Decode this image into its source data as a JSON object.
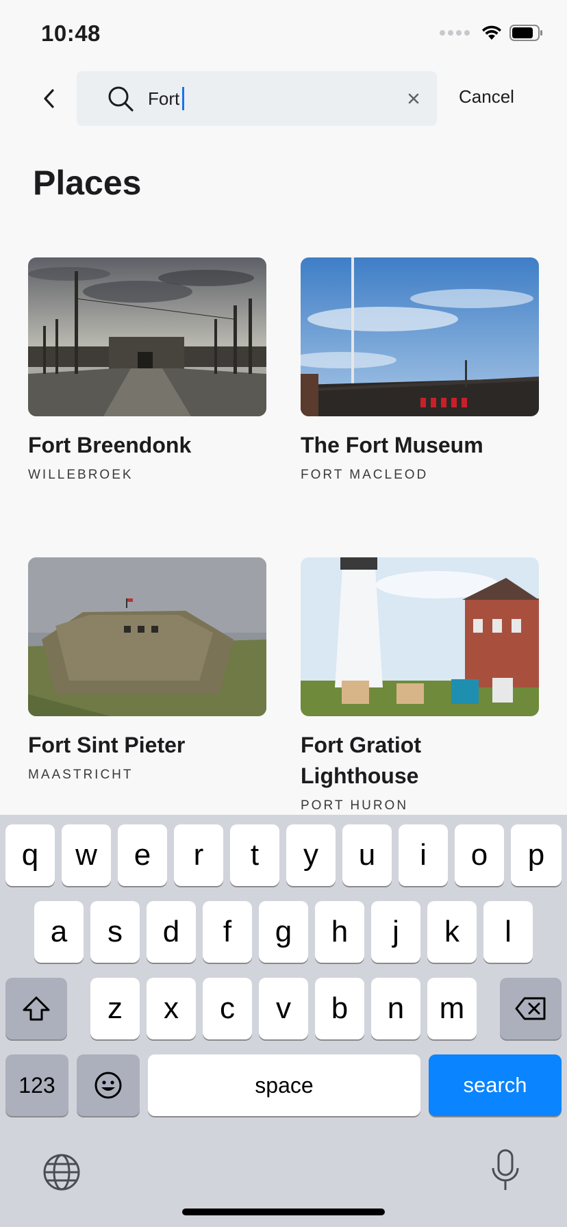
{
  "status": {
    "time": "10:48"
  },
  "search": {
    "query": "Fort",
    "cancel_label": "Cancel"
  },
  "section": {
    "title": "Places"
  },
  "places": [
    {
      "title": "Fort Breendonk",
      "location": "WILLEBROEK"
    },
    {
      "title": "The Fort Museum",
      "location": "FORT MACLEOD"
    },
    {
      "title": "Fort Sint Pieter",
      "location": "MAASTRICHT"
    },
    {
      "title": "Fort Gratiot Lighthouse",
      "location": "PORT HURON"
    }
  ],
  "keyboard": {
    "row1": [
      "q",
      "w",
      "e",
      "r",
      "t",
      "y",
      "u",
      "i",
      "o",
      "p"
    ],
    "row2": [
      "a",
      "s",
      "d",
      "f",
      "g",
      "h",
      "j",
      "k",
      "l"
    ],
    "row3": [
      "z",
      "x",
      "c",
      "v",
      "b",
      "n",
      "m"
    ],
    "numbers_label": "123",
    "space_label": "space",
    "search_label": "search"
  },
  "colors": {
    "accent": "#0a84ff",
    "caret": "#1a73e8",
    "keyboard_bg": "#d1d4db"
  },
  "icons": [
    "back-chevron-icon",
    "search-icon",
    "clear-icon",
    "wifi-icon",
    "battery-icon",
    "shift-icon",
    "delete-icon",
    "emoji-icon",
    "globe-icon",
    "microphone-icon"
  ]
}
